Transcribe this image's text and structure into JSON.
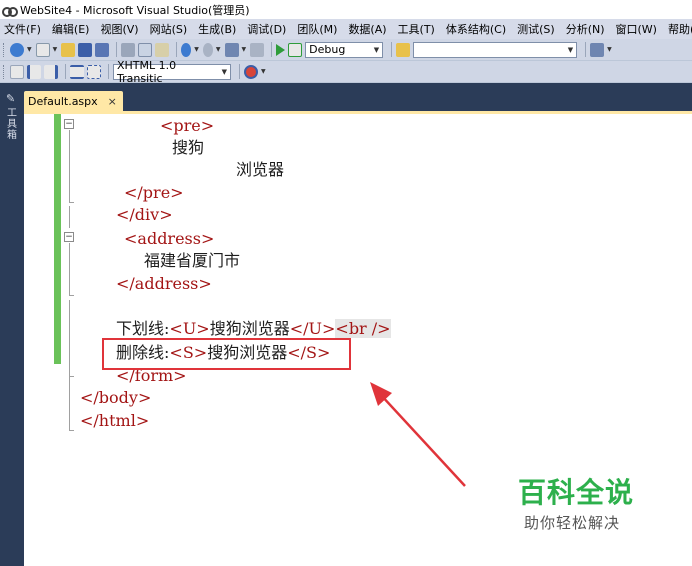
{
  "window": {
    "title": "WebSite4 - Microsoft Visual Studio(管理员)"
  },
  "menu": [
    "文件(F)",
    "编辑(E)",
    "视图(V)",
    "网站(S)",
    "生成(B)",
    "调试(D)",
    "团队(M)",
    "数据(A)",
    "工具(T)",
    "体系结构(C)",
    "测试(S)",
    "分析(N)",
    "窗口(W)",
    "帮助(H)"
  ],
  "toolbar": {
    "config": "Debug",
    "doctype": "XHTML 1.0 Transitic",
    "find": ""
  },
  "toolbox": {
    "label": "工具箱"
  },
  "tab": {
    "name": "Default.aspx",
    "close": "×"
  },
  "code": {
    "l1": "<pre>",
    "l2": "搜狗",
    "l3": "浏览器",
    "l4": "</pre>",
    "l5": "</div>",
    "l6": "<address>",
    "l7": "福建省厦门市",
    "l8": "</address>",
    "l9a": "下划线:",
    "l9b": "<U>",
    "l9c": "搜狗浏览器",
    "l9d": "</U>",
    "l9e": "<br />",
    "l10a": "删除线:",
    "l10b": "<S>",
    "l10c": "搜狗浏览器",
    "l10d": "</S>",
    "l11": "</form>",
    "l12": "</body>",
    "l13": "</html>"
  },
  "watermark": {
    "title": "百科全说",
    "subtitle": "助你轻松解决"
  },
  "colors": {
    "accent": "#6ac259",
    "annotation": "#e0343a",
    "watermark": "#2db04c"
  }
}
